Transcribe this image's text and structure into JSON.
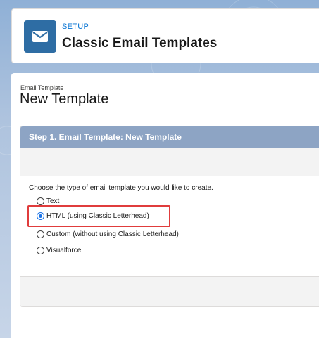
{
  "header": {
    "section_label": "SETUP",
    "title": "Classic Email Templates",
    "icon": "envelope-icon"
  },
  "content": {
    "breadcrumb": "Email Template",
    "title": "New Template"
  },
  "step": {
    "header": "Step 1. Email Template: New Template",
    "prompt": "Choose the type of email template you would like to create.",
    "options": [
      {
        "label": "Text",
        "checked": false
      },
      {
        "label": "HTML (using Classic Letterhead)",
        "checked": true
      },
      {
        "label": "Custom (without using Classic Letterhead)",
        "checked": false
      },
      {
        "label": "Visualforce",
        "checked": false
      }
    ]
  },
  "colors": {
    "accent": "#0070d2",
    "icon_bg": "#2e6da4",
    "step_header_bg": "#8da4c4",
    "highlight": "#e03c3c"
  }
}
